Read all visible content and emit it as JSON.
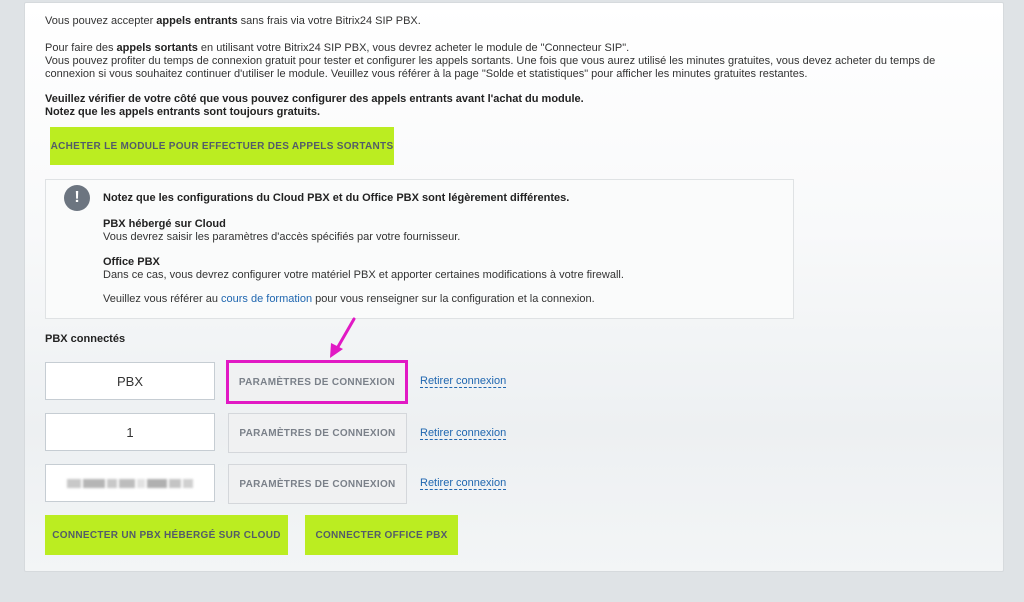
{
  "intro": {
    "line1_prefix": "Vous pouvez accepter ",
    "line1_bold": "appels entrants",
    "line1_suffix": " sans frais via votre Bitrix24 SIP PBX.",
    "line2_prefix": "Pour faire des ",
    "line2_bold": "appels sortants",
    "line2_suffix": " en utilisant votre Bitrix24 SIP PBX, vous devrez acheter le module de \"Connecteur SIP\".",
    "line3": "Vous pouvez profiter du temps de connexion gratuit pour tester et configurer les appels sortants. Une fois que vous aurez utilisé les minutes gratuites, vous devez acheter du temps de",
    "line4": "connexion si vous souhaitez continuer d'utiliser le module. Veuillez vous référer à la page \"Solde et statistiques\" pour afficher les minutes gratuites restantes.",
    "warn1": "Veuillez vérifier de votre côté que vous pouvez configurer des appels entrants avant l'achat du module.",
    "warn2": "Notez que les appels entrants sont toujours gratuits."
  },
  "buy_button": "ACHETER LE MODULE POUR EFFECTUER DES APPELS SORTANTS",
  "info": {
    "icon": "!",
    "heading": "Notez que les configurations du Cloud PBX et du Office PBX sont légèrement différentes.",
    "cloud_title": "PBX hébergé sur Cloud",
    "cloud_text": "Vous devrez saisir les paramètres d'accès spécifiés par votre fournisseur.",
    "office_title": "Office PBX",
    "office_text": "Dans ce cas, vous devrez configurer votre matériel PBX et apporter certaines modifications à votre firewall.",
    "footer_prefix": "Veuillez vous référer au ",
    "footer_link": "cours de formation",
    "footer_suffix": " pour vous renseigner sur la configuration et la connexion."
  },
  "connected_title": "PBX connectés",
  "pbx_rows": [
    {
      "name": "PBX",
      "settings": "PARAMÈTRES DE CONNEXION",
      "remove": "Retirer connexion"
    },
    {
      "name": "1",
      "settings": "PARAMÈTRES DE CONNEXION",
      "remove": "Retirer connexion"
    },
    {
      "name": "",
      "settings": "PARAMÈTRES DE CONNEXION",
      "remove": "Retirer connexion"
    }
  ],
  "actions": {
    "connect_cloud": "CONNECTER UN PBX HÉBERGÉ SUR CLOUD",
    "connect_office": "CONNECTER OFFICE PBX"
  },
  "colors": {
    "accent_green": "#bbed21",
    "highlight_magenta": "#e119c4",
    "link_blue": "#2067b0"
  }
}
